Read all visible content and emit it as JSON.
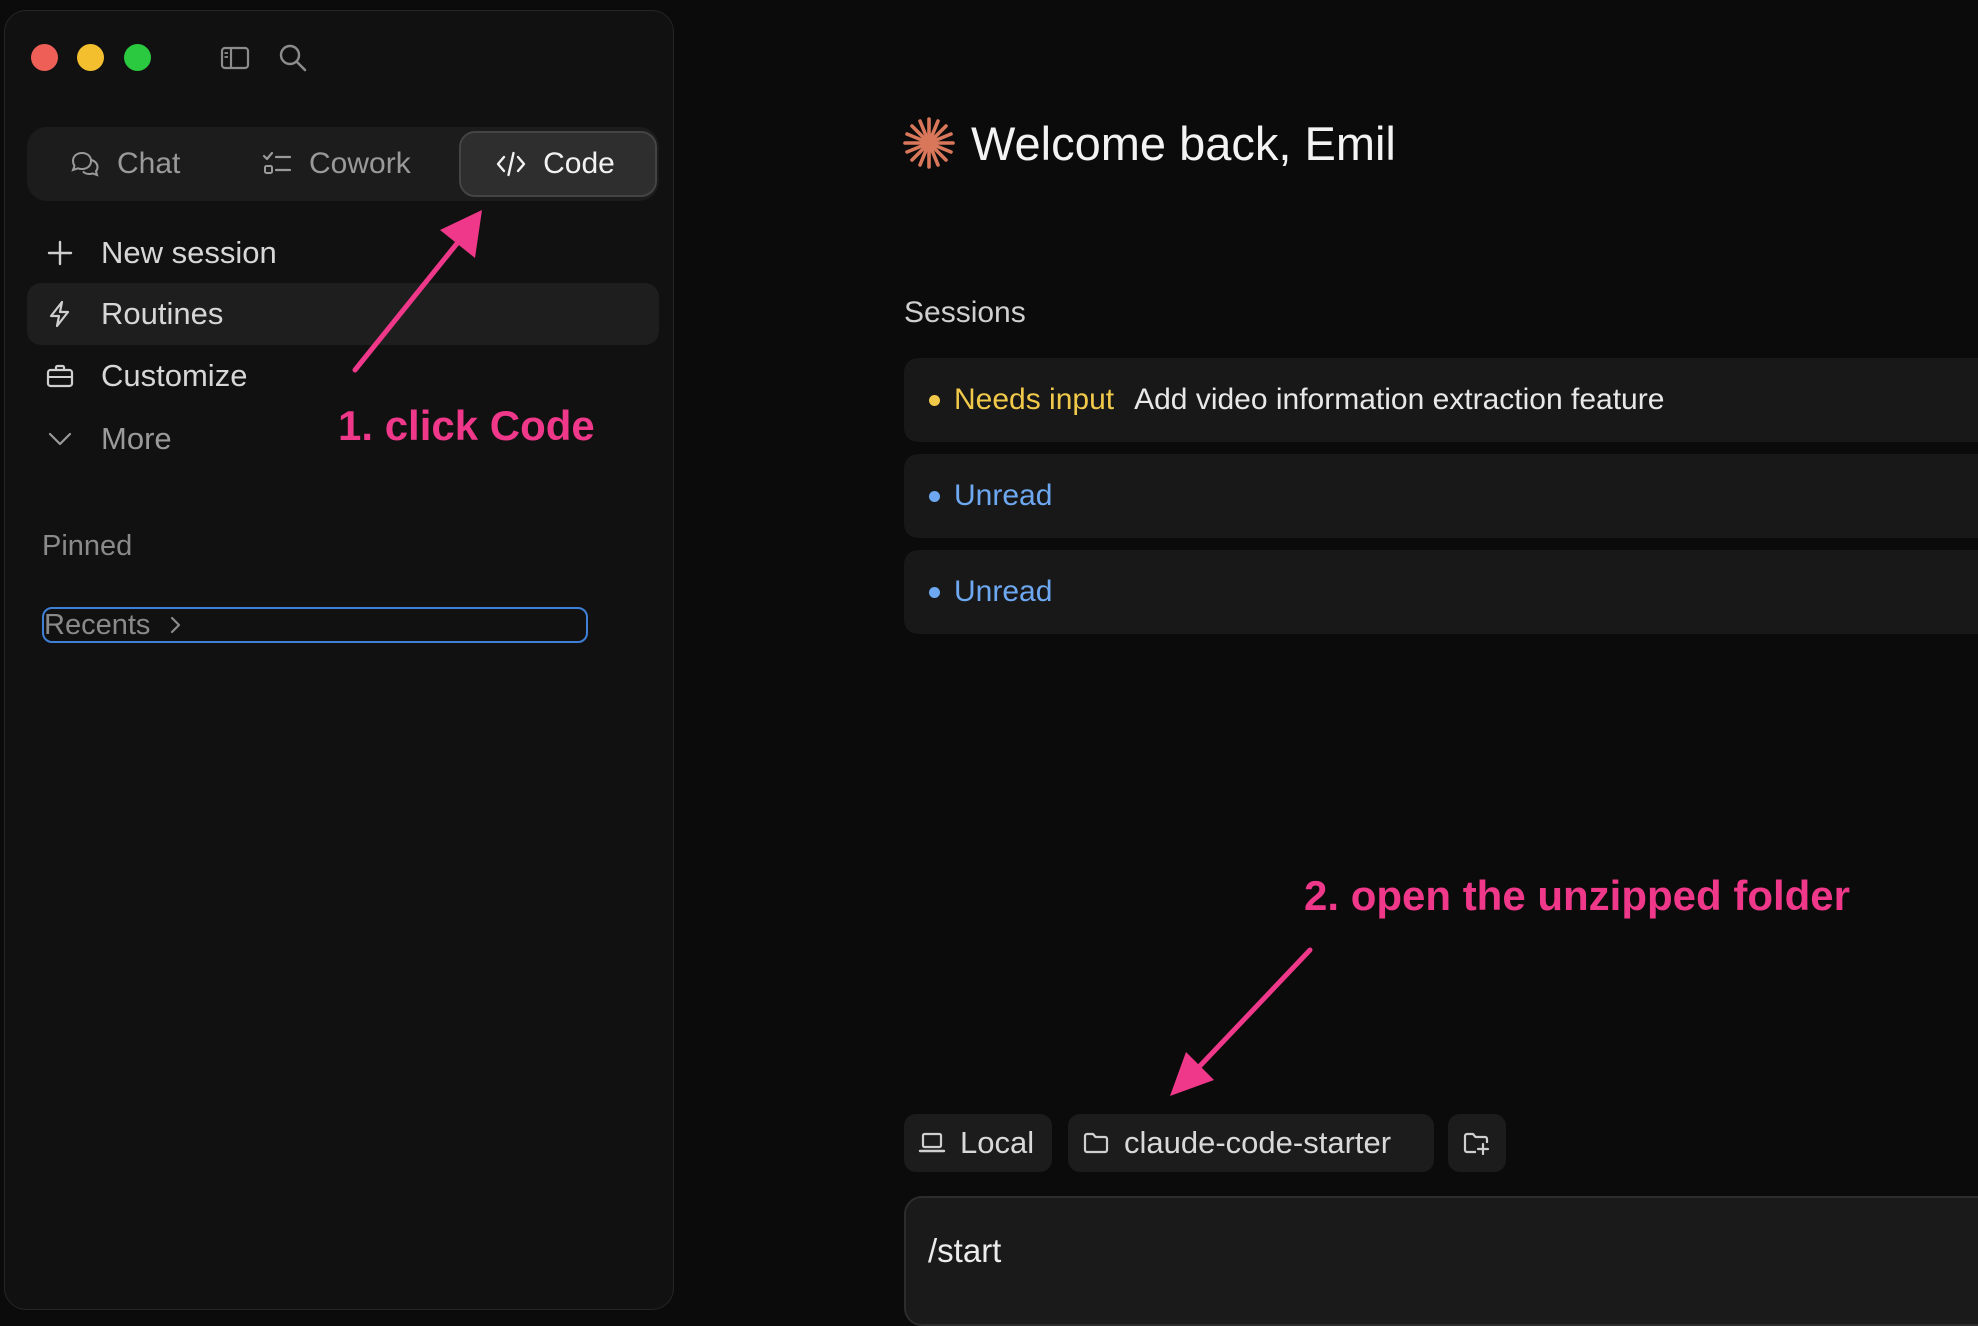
{
  "sidebar": {
    "modes": [
      {
        "label": "Chat",
        "icon": "chat-bubbles-icon"
      },
      {
        "label": "Cowork",
        "icon": "checklist-icon"
      },
      {
        "label": "Code",
        "icon": "code-brackets-icon"
      }
    ],
    "active_mode": "Code",
    "nav": [
      {
        "label": "New session",
        "icon": "plus-icon"
      },
      {
        "label": "Routines",
        "icon": "lightning-icon"
      },
      {
        "label": "Customize",
        "icon": "briefcase-icon"
      },
      {
        "label": "More",
        "icon": "chevron-down-icon"
      }
    ],
    "pinned_label": "Pinned",
    "recents_label": "Recents"
  },
  "main": {
    "welcome": "Welcome back, Emil",
    "sessions_label": "Sessions",
    "sessions": [
      {
        "status": "Needs input",
        "title": "Add video information extraction feature",
        "status_color": "#f1c94a"
      },
      {
        "status": "Unread",
        "title": "",
        "status_color": "#6ea8f0"
      },
      {
        "status": "Unread",
        "title": "",
        "status_color": "#6ea8f0"
      }
    ],
    "env_chip": "Local",
    "folder_chip": "claude-code-starter",
    "composer_text": "/start"
  },
  "annotations": {
    "step1": "1. click Code",
    "step2": "2. open the unzipped folder",
    "color": "#f0388a"
  },
  "colors": {
    "accent_logo": "#d9775a",
    "focus_ring": "#3f7fd6"
  }
}
